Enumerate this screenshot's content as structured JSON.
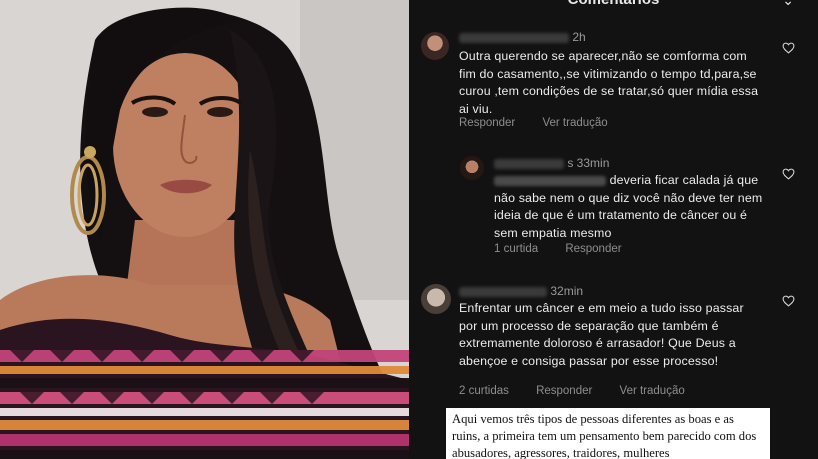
{
  "panel": {
    "title": "Comentários",
    "close_glyph": "⌄"
  },
  "comments": [
    {
      "time": "2h",
      "text": "Outra querendo se aparecer,não se comforma com fim do casamento,,se vitimizando o tempo td,para,se curou ,tem condições de se tratar,só quer mídia essa ai viu.",
      "actions": [
        "Responder",
        "Ver tradução"
      ]
    },
    {
      "time": "s 33min",
      "text_tail": "deveria ficar calada já que não sabe nem o que diz você não deve ter nem ideia de que é um tratamento de câncer ou é sem empatia mesmo",
      "actions": [
        "1 curtida",
        "Responder"
      ]
    },
    {
      "time": "32min",
      "text": "Enfrentar um câncer e em meio a tudo isso passar por um processo de separação que também é extremamente doloroso é arrasador! Que Deus a abençoe e consiga passar por esse processo!",
      "actions": [
        "2 curtidas",
        "Responder",
        "Ver tradução"
      ]
    }
  ],
  "caption": {
    "text": "Aqui vemos três tipos de pessoas diferentes as boas e as ruins, a primeira tem um pensamento bem parecido com dos abusadores, agressores, traidores, mulheres"
  },
  "icons": {
    "like": "heart-icon"
  },
  "colors": {
    "panel_bg": "#121212",
    "text": "#ececec",
    "muted": "#8e8e8e"
  }
}
